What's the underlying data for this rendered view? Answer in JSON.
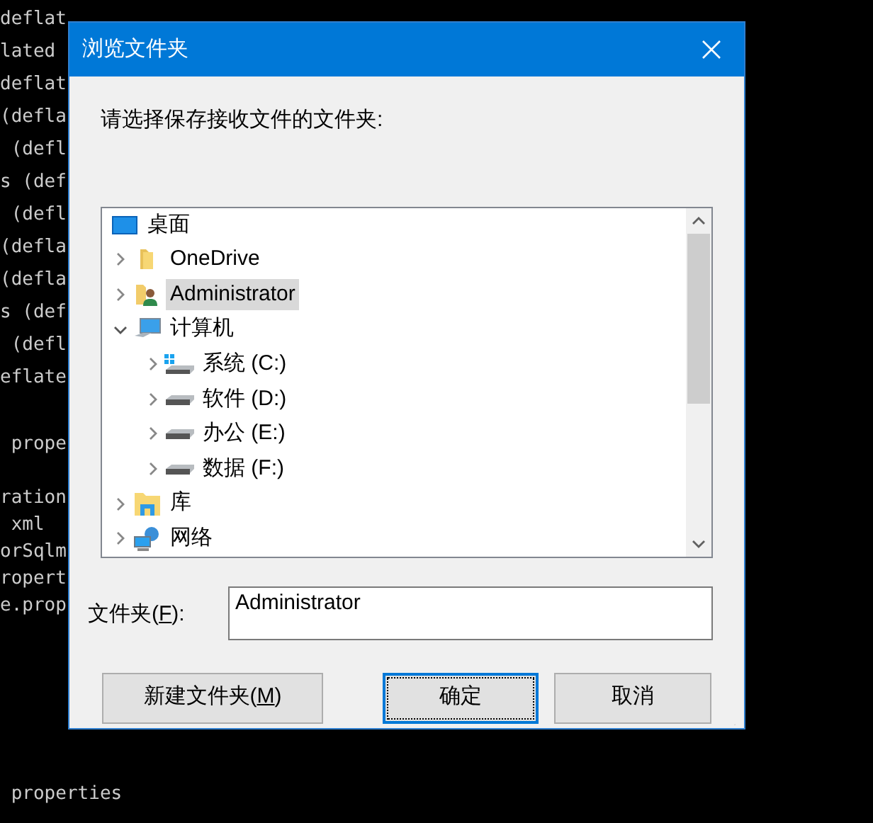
{
  "terminal": {
    "blocks": [
      [
        "deflat",
        "lated",
        "deflat",
        "(defla",
        " (defl",
        "s (def",
        " (defl",
        "(defla",
        "(defla",
        "s (def",
        " (defl",
        "eflate"
      ],
      [
        " prope"
      ],
      [
        "ration",
        " xml",
        "orSqlm",
        "ropert",
        "e.prop"
      ],
      [
        " properties"
      ]
    ]
  },
  "dialog": {
    "title": "浏览文件夹",
    "prompt": "请选择保存接收文件的文件夹:",
    "tree": {
      "label": "桌面",
      "kind": "desktop",
      "selected": false,
      "children": [
        {
          "label": "OneDrive",
          "kind": "folder",
          "expanded": false,
          "selected": false
        },
        {
          "label": "Administrator",
          "kind": "user-folder",
          "expanded": false,
          "selected": true
        },
        {
          "label": "计算机",
          "kind": "computer",
          "expanded": true,
          "selected": false,
          "children": [
            {
              "label": "系统 (C:)",
              "kind": "system-drive",
              "expanded": false,
              "selected": false
            },
            {
              "label": "软件 (D:)",
              "kind": "drive",
              "expanded": false,
              "selected": false
            },
            {
              "label": "办公 (E:)",
              "kind": "drive",
              "expanded": false,
              "selected": false
            },
            {
              "label": "数据 (F:)",
              "kind": "drive",
              "expanded": false,
              "selected": false
            }
          ]
        },
        {
          "label": "库",
          "kind": "library",
          "expanded": false,
          "selected": false
        },
        {
          "label": "网络",
          "kind": "network",
          "expanded": false,
          "selected": false
        }
      ]
    },
    "folder_label": [
      "文件夹(",
      "F",
      "):"
    ],
    "folder_value": "Administrator",
    "buttons": [
      {
        "parts": [
          "新建文件夹(",
          "M",
          ")"
        ],
        "focused": false
      },
      {
        "parts": [
          "确定"
        ],
        "focused": true
      },
      {
        "parts": [
          "取消"
        ],
        "focused": false
      }
    ]
  }
}
